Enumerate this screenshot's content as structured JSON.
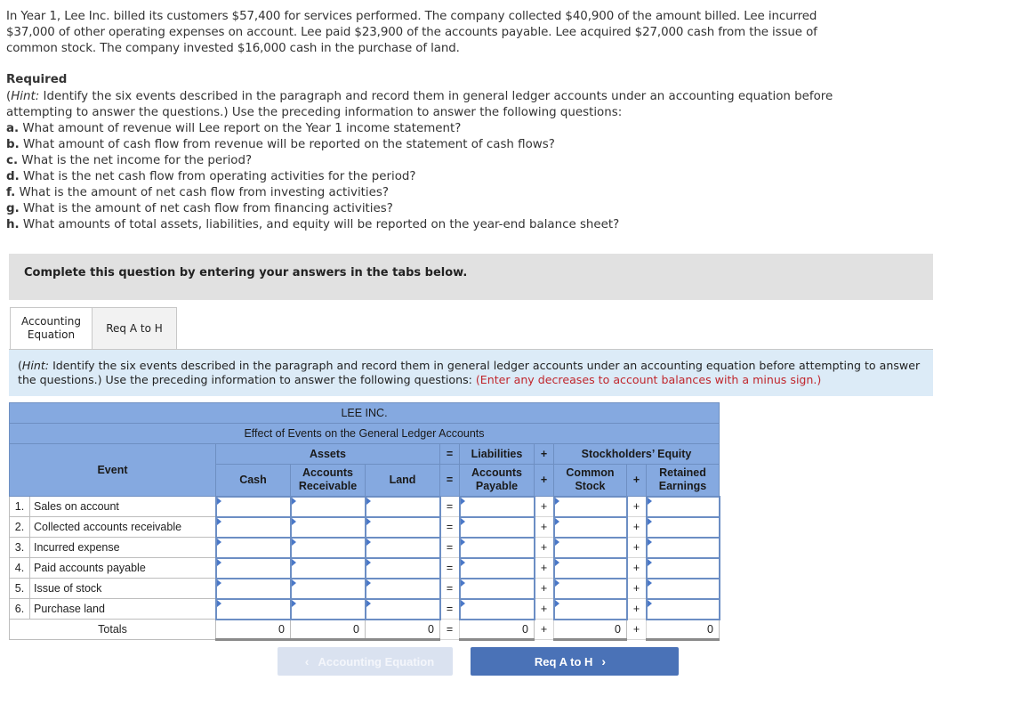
{
  "intro": {
    "paragraph": "In Year 1, Lee Inc. billed its customers $57,400 for services performed. The company collected $40,900 of the amount billed. Lee incurred $37,000 of other operating expenses on account. Lee paid $23,900 of the accounts payable. Lee acquired $27,000 cash from the issue of common stock. The company invested $16,000 cash in the purchase of land."
  },
  "required": {
    "title": "Required",
    "hint_label": "Hint:",
    "hint_text": " Identify the six events described in the paragraph and record them in general ledger accounts under an accounting equation before attempting to answer the questions.) Use the preceding information to answer the following questions:",
    "questions": [
      {
        "letter": "a.",
        "text": " What amount of revenue will Lee report on the Year 1 income statement?"
      },
      {
        "letter": "b.",
        "text": " What amount of cash flow from revenue will be reported on the statement of cash flows?"
      },
      {
        "letter": "c.",
        "text": " What is the net income for the period?"
      },
      {
        "letter": "d.",
        "text": " What is the net cash flow from operating activities for the period?"
      },
      {
        "letter": "f.",
        "text": " What is the amount of net cash flow from investing activities?"
      },
      {
        "letter": "g.",
        "text": " What is the amount of net cash flow from financing activities?"
      },
      {
        "letter": "h.",
        "text": " What amounts of total assets, liabilities, and equity will be reported on the year-end balance sheet?"
      }
    ]
  },
  "banner": "Complete this question by entering your answers in the tabs below.",
  "tabs": [
    {
      "label_line1": "Accounting",
      "label_line2": "Equation",
      "active": true
    },
    {
      "label": "Req A to H",
      "active": false
    }
  ],
  "tab_hint": {
    "label": "Hint:",
    "text": " Identify the six events described in the paragraph and record them in general ledger accounts under an accounting equation before attempting to answer the questions.) Use the preceding information to answer the following questions: ",
    "red_note": "(Enter any decreases to account balances with a minus sign.)"
  },
  "ledger": {
    "company": "LEE INC.",
    "subtitle": "Effect of Events on the General Ledger Accounts",
    "groups": {
      "assets": "Assets",
      "liabilities": "Liabilities",
      "equity": "Stockholders’ Equity"
    },
    "event_header": "Event",
    "columns": {
      "cash": "Cash",
      "ar_1": "Accounts",
      "ar_2": "Receivable",
      "land": "Land",
      "ap_1": "Accounts",
      "ap_2": "Payable",
      "cs_1": "Common",
      "cs_2": "Stock",
      "re_1": "Retained",
      "re_2": "Earnings"
    },
    "ops": {
      "eq": "=",
      "plus": "+"
    },
    "events": [
      {
        "num": "1.",
        "label": "Sales on account"
      },
      {
        "num": "2.",
        "label": "Collected accounts receivable"
      },
      {
        "num": "3.",
        "label": "Incurred expense"
      },
      {
        "num": "4.",
        "label": "Paid accounts payable"
      },
      {
        "num": "5.",
        "label": "Issue of stock"
      },
      {
        "num": "6.",
        "label": "Purchase land"
      }
    ],
    "totals": {
      "label": "Totals",
      "cash": "0",
      "ar": "0",
      "land": "0",
      "ap": "0",
      "cs": "0",
      "re": "0"
    }
  },
  "nav": {
    "prev_label": "Accounting Equation",
    "next_label": "Req A to H"
  }
}
